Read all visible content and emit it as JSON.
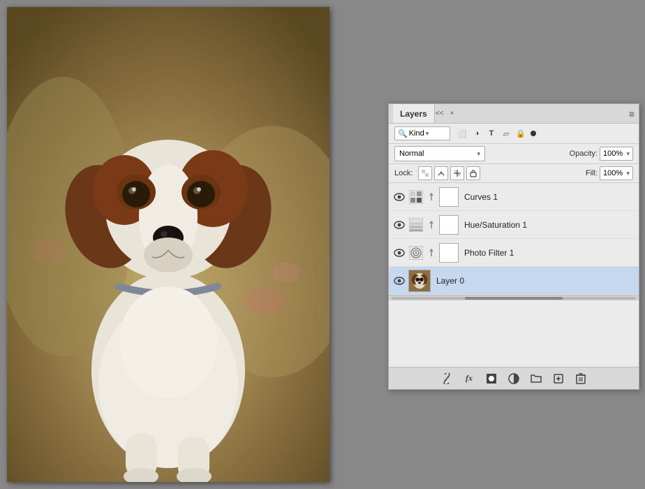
{
  "app": {
    "background_color": "#888888"
  },
  "canvas": {
    "image_alt": "Dog photo - Jack Russell Terrier puppy"
  },
  "panel": {
    "title": "Layers",
    "collapse_label": "<<",
    "close_label": "×",
    "menu_label": "≡",
    "filter_row": {
      "kind_label": "Kind",
      "icons": [
        "image-icon",
        "circle-icon",
        "text-icon",
        "shape-icon",
        "lock-icon"
      ],
      "dot_label": "●"
    },
    "blend_row": {
      "blend_mode": "Normal",
      "blend_arrow": "▾",
      "opacity_label": "Opacity:",
      "opacity_value": "100%",
      "opacity_arrow": "▾"
    },
    "lock_row": {
      "lock_label": "Lock:",
      "lock_icons": [
        "checkerboard",
        "brush",
        "move",
        "lock"
      ],
      "fill_label": "Fill:",
      "fill_value": "100%",
      "fill_arrow": "▾"
    },
    "layers": [
      {
        "id": "curves-1",
        "name": "Curves 1",
        "visible": true,
        "selected": false,
        "type": "adjustment",
        "subtype": "curves",
        "has_mask": true,
        "has_link": true
      },
      {
        "id": "hue-saturation-1",
        "name": "Hue/Saturation 1",
        "visible": true,
        "selected": false,
        "type": "adjustment",
        "subtype": "hue-saturation",
        "has_mask": true,
        "has_link": true
      },
      {
        "id": "photo-filter-1",
        "name": "Photo Filter 1",
        "visible": true,
        "selected": false,
        "type": "adjustment",
        "subtype": "photo-filter",
        "has_mask": true,
        "has_link": true
      },
      {
        "id": "layer-0",
        "name": "Layer 0",
        "visible": true,
        "selected": true,
        "type": "pixel",
        "subtype": "image",
        "has_mask": false,
        "has_link": false
      }
    ],
    "bottom_buttons": [
      {
        "id": "link-btn",
        "icon": "🔗",
        "label": "Link Layers"
      },
      {
        "id": "fx-btn",
        "icon": "fx",
        "label": "Add Layer Style"
      },
      {
        "id": "mask-btn",
        "icon": "⬛",
        "label": "Add Layer Mask"
      },
      {
        "id": "adjustment-btn",
        "icon": "◑",
        "label": "New Fill or Adjustment Layer"
      },
      {
        "id": "folder-btn",
        "icon": "📁",
        "label": "New Group"
      },
      {
        "id": "new-layer-btn",
        "icon": "📄",
        "label": "New Layer"
      },
      {
        "id": "delete-btn",
        "icon": "🗑",
        "label": "Delete Layer"
      }
    ]
  }
}
